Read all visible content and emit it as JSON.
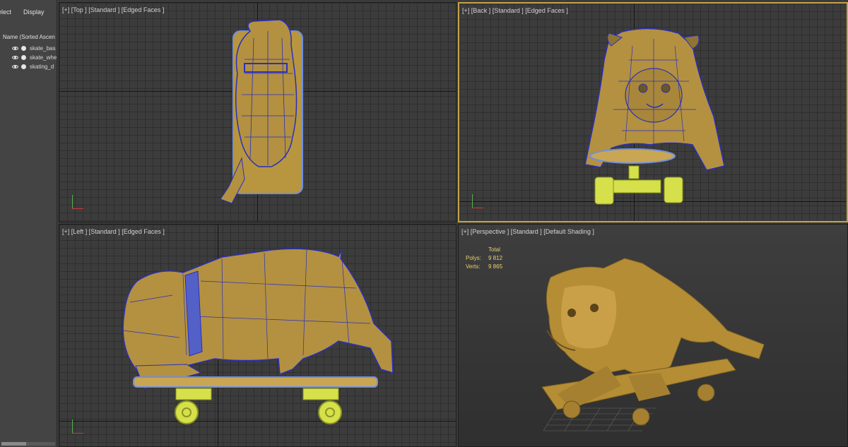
{
  "panel": {
    "tab_select": "elect",
    "tab_display": "Display",
    "tree_header": "Name (Sorted Ascen",
    "items": [
      {
        "label": "skate_bas"
      },
      {
        "label": "skate_whe"
      },
      {
        "label": "skating_d"
      }
    ]
  },
  "viewports": {
    "top": {
      "label": "[+] [Top ] [Standard ] [Edged Faces ]"
    },
    "back": {
      "label": "[+] [Back ] [Standard ] [Edged Faces ]"
    },
    "left": {
      "label": "[+] [Left ] [Standard ] [Edged Faces ]"
    },
    "perspective": {
      "label": "[+] [Perspective ] [Standard ] [Default Shading ]"
    }
  },
  "stats": {
    "header": "Total",
    "polys_label": "Polys:",
    "polys_value": "9 812",
    "verts_label": "Verts:",
    "verts_value": "9 865"
  },
  "colors": {
    "model_fill": "#b8963f",
    "wire": "#2a2fbf",
    "wheels": "#d6e04a",
    "selection_border": "#c5a44a",
    "stats_text": "#e9d16c"
  }
}
